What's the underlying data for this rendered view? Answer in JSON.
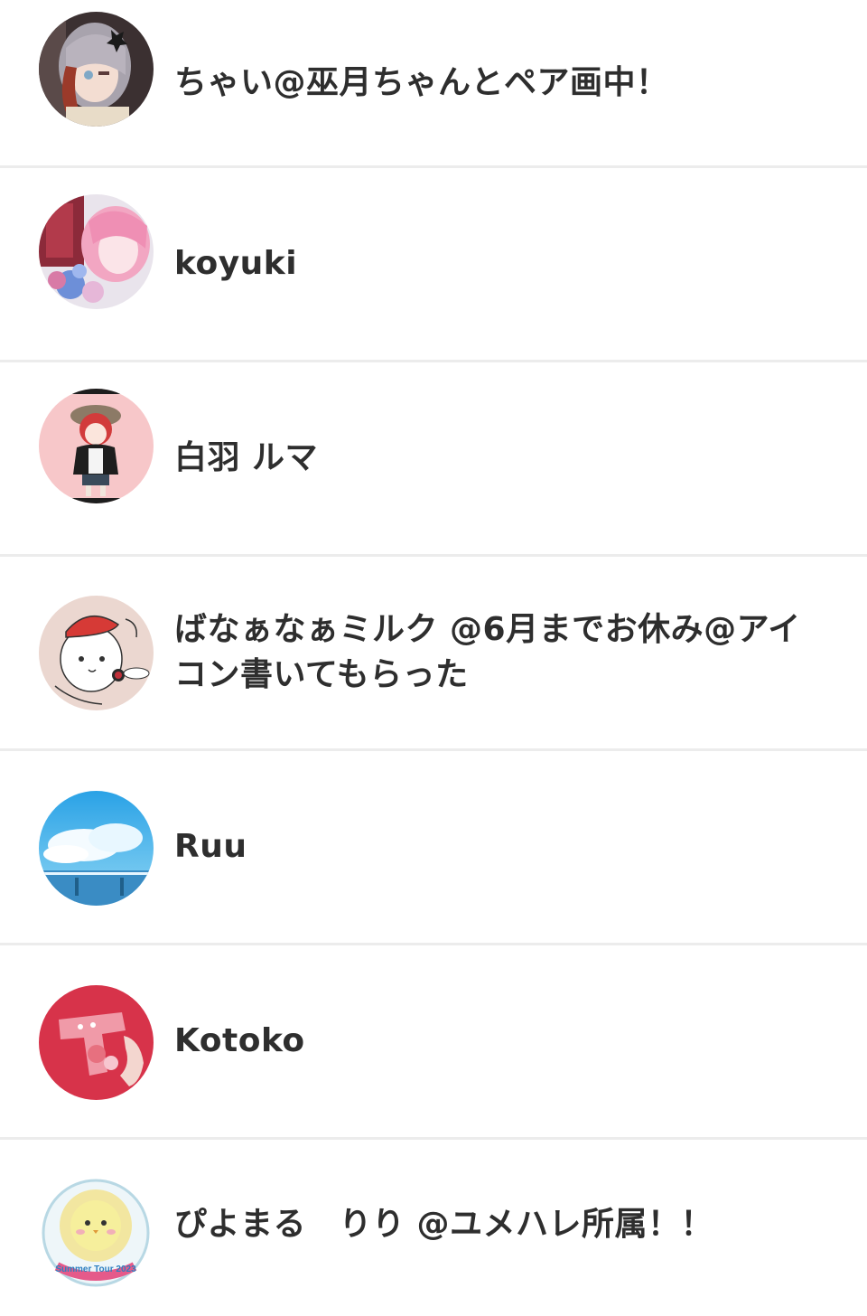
{
  "users": [
    {
      "name": "ちゃい@巫月ちゃんとペア画中！",
      "avatar_icon": "avatar-anime-girl-grey-hair"
    },
    {
      "name": "koyuki",
      "avatar_icon": "avatar-anime-pink-hair-flowers"
    },
    {
      "name": "白羽 ルマ",
      "avatar_icon": "avatar-chibi-red-hair-hat"
    },
    {
      "name": "ばなぁなぁミルク @6月までお休み@アイコン書いてもらった",
      "avatar_icon": "avatar-sketch-character-red-beret"
    },
    {
      "name": "Ruu",
      "avatar_icon": "avatar-blue-sky-clouds"
    },
    {
      "name": "Kotoko",
      "avatar_icon": "avatar-red-toy-gun"
    },
    {
      "name": "ぴよまる　りり @ユメハレ所属！！",
      "avatar_icon": "avatar-yellow-chick-badge"
    }
  ],
  "avatar_badge_text": "Summer Tour 2023"
}
